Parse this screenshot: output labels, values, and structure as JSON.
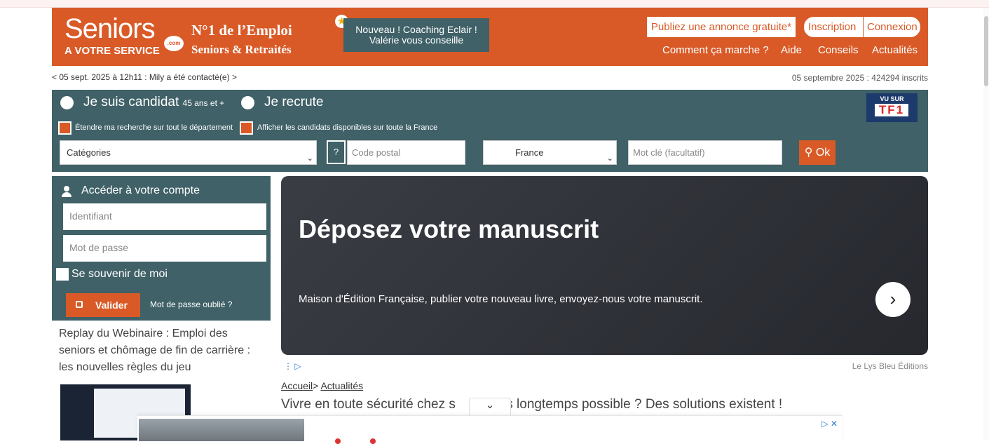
{
  "header": {
    "logo_main": "Seniors",
    "logo_dot": ".com",
    "logo_sub": "A VOTRE SERVICE",
    "tagline1": "N°1 de l’Emploi",
    "tagline2": "Seniors & Retraités",
    "coaching_line1": "Nouveau ! Coaching Eclair !",
    "coaching_line2": "Valérie vous conseille",
    "publish_label": "Publiez une annonce gratuite*",
    "inscription_label": "Inscription",
    "connexion_label": "Connexion",
    "nav": [
      "Comment ça marche ?",
      "Aide",
      "Conseils",
      "Actualités"
    ]
  },
  "infobar": {
    "left": "< 05 sept. 2025 à 12h11 : Mily a été contacté(e) >",
    "right": "05 septembre 2025 : 424294 inscrits"
  },
  "search": {
    "candidate_label": "Je suis candidat",
    "candidate_age": "45 ans et +",
    "recruiter_label": "Je recrute",
    "extend_label": "Étendre ma recherche sur tout le département",
    "show_label": "Afficher les candidats disponibles sur toute la France",
    "category_value": "Catégories",
    "help_label": "?",
    "postal_placeholder": "Code postal",
    "country_value": "France",
    "keyword_placeholder": "Mot clé (facultatif)",
    "ok_label": "Ok",
    "tf1_vu": "VU SUR",
    "tf1_logo": "TF1"
  },
  "login": {
    "title": "Accéder à votre compte",
    "username_placeholder": "Identifiant",
    "password_placeholder": "Mot de passe",
    "remember_label": "Se souvenir de moi",
    "submit_label": "Valider",
    "forgot_label": "Mot de passe oublié ?"
  },
  "webinar": {
    "title": "Replay du Webinaire : Emploi des seniors et chômage de fin de carrière : les nouvelles règles du jeu"
  },
  "ad": {
    "title": "Déposez votre manuscrit",
    "description": "Maison d'Édition Française, publier votre nouveau livre, envoyez-nous votre manuscrit.",
    "source": "Le Lys Bleu Éditions",
    "arrow": "›"
  },
  "breadcrumb": {
    "home": "Accueil",
    "sep": ">",
    "current": "Actualités"
  },
  "article": {
    "title_part1": "Vivre en toute sécurité chez s",
    "title_part2": "plus longtemps possible ? Des solutions existent !"
  },
  "colors": {
    "brand_orange": "#d95a27",
    "teal": "#3f6167"
  }
}
